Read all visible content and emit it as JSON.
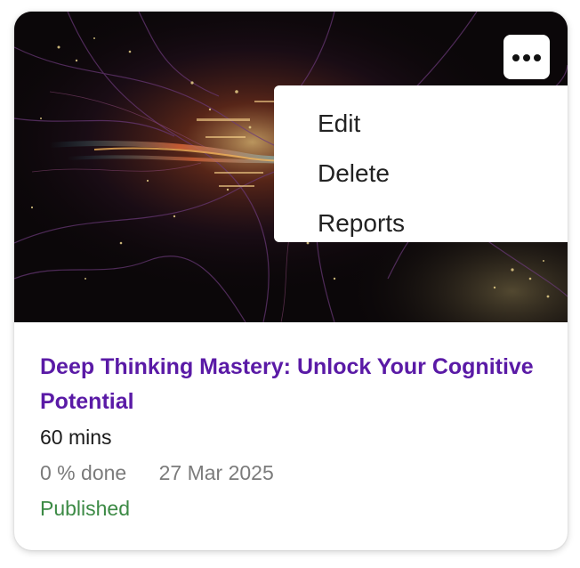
{
  "card": {
    "title": "Deep Thinking Mastery: Unlock Your Cognitive Potential",
    "duration": "60 mins",
    "progress": "0 % done",
    "progress_value": 0,
    "date": "27 Mar 2025",
    "status": "Published",
    "cover_image": "abstract neural network art"
  },
  "menu": {
    "icon": "more-horizontal-icon",
    "items": [
      "Edit",
      "Delete",
      "Reports"
    ]
  },
  "colors": {
    "title": "#5a1aa6",
    "status": "#3c8a45",
    "meta": "#7b7b7b",
    "text": "#1a1a1a"
  }
}
